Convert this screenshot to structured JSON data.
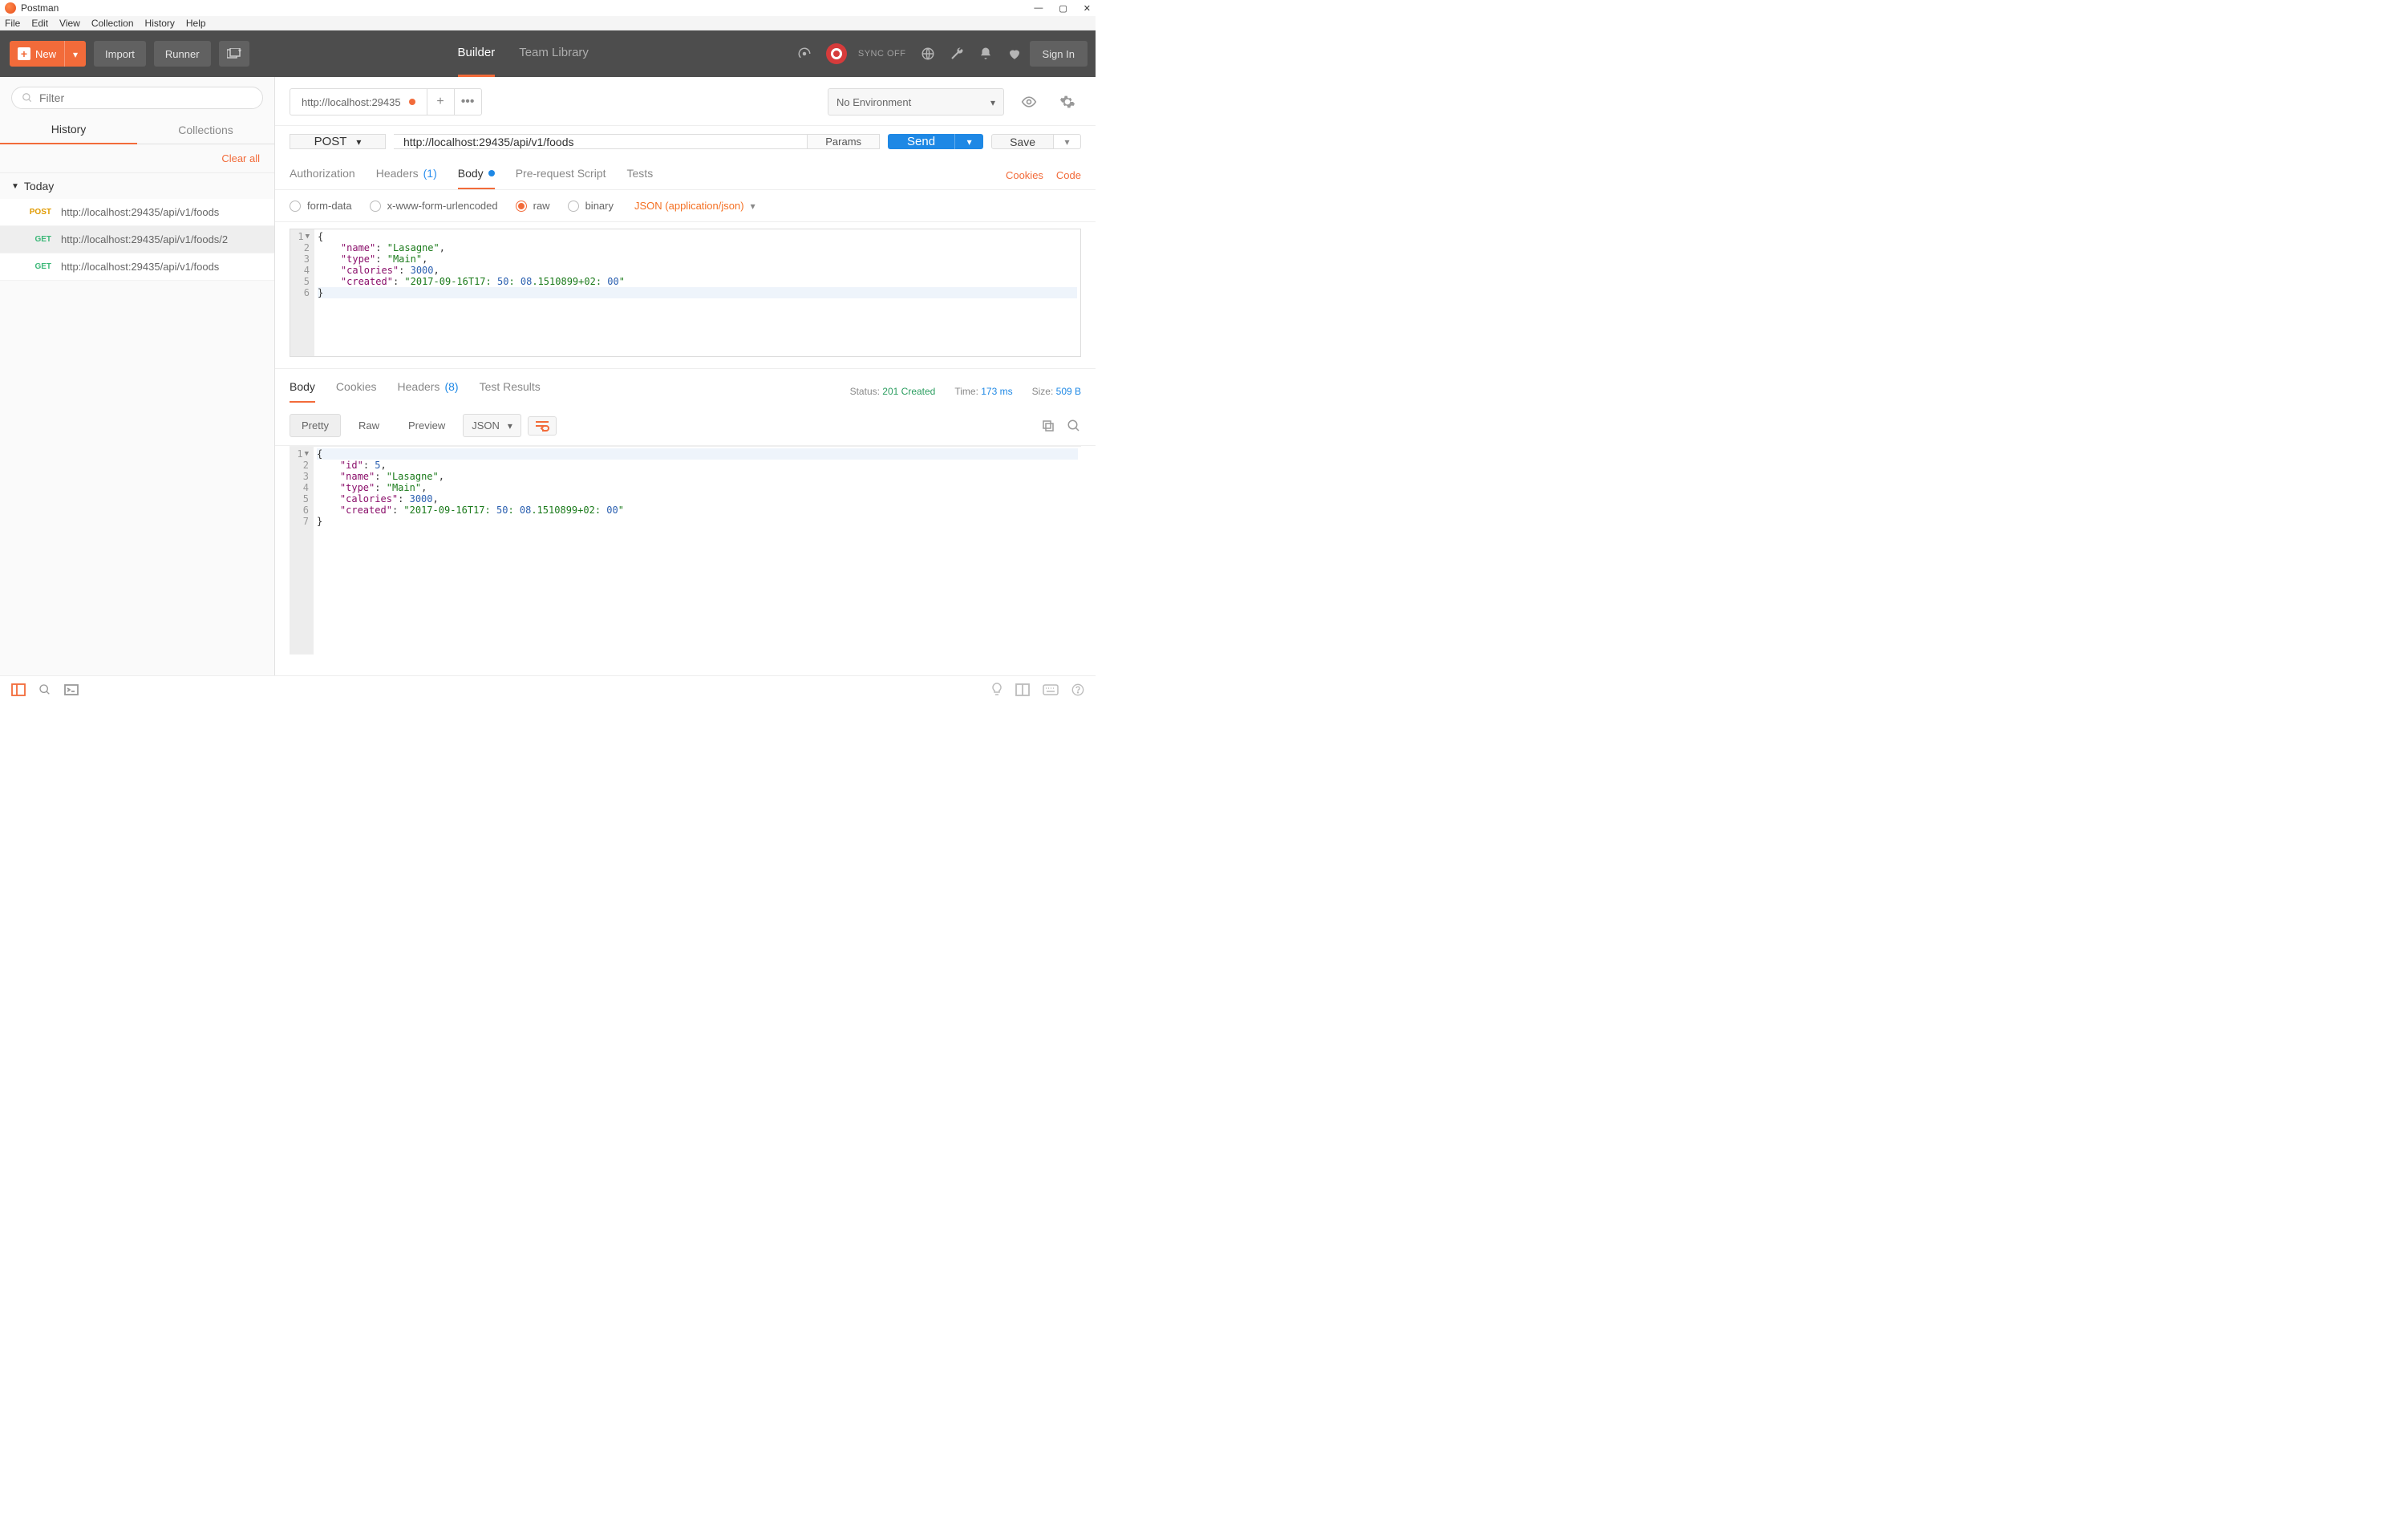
{
  "window": {
    "title": "Postman"
  },
  "menubar": [
    "File",
    "Edit",
    "View",
    "Collection",
    "History",
    "Help"
  ],
  "toolbar": {
    "new_label": "New",
    "import_label": "Import",
    "runner_label": "Runner",
    "tabs": {
      "builder": "Builder",
      "team_library": "Team Library"
    },
    "sync_label": "SYNC OFF",
    "sign_in": "Sign In"
  },
  "sidebar": {
    "filter_placeholder": "Filter",
    "tabs": {
      "history": "History",
      "collections": "Collections"
    },
    "clear_all": "Clear all",
    "group": "Today",
    "history": [
      {
        "method": "POST",
        "url": "http://localhost:29435/api/v1/foods",
        "selected": false
      },
      {
        "method": "GET",
        "url": "http://localhost:29435/api/v1/foods/2",
        "selected": true
      },
      {
        "method": "GET",
        "url": "http://localhost:29435/api/v1/foods",
        "selected": false
      }
    ]
  },
  "request": {
    "tab_title": "http://localhost:29435",
    "environment": "No Environment",
    "method": "POST",
    "url": "http://localhost:29435/api/v1/foods",
    "params_label": "Params",
    "send_label": "Send",
    "save_label": "Save",
    "subtabs": {
      "authorization": "Authorization",
      "headers": "Headers",
      "headers_count": "(1)",
      "body": "Body",
      "prerequest": "Pre-request Script",
      "tests": "Tests"
    },
    "cookies_label": "Cookies",
    "code_label": "Code",
    "body_types": {
      "form_data": "form-data",
      "x_www": "x-www-form-urlencoded",
      "raw": "raw",
      "binary": "binary"
    },
    "content_type": "JSON (application/json)",
    "body_lines": [
      "{",
      "    \"name\": \"Lasagne\",",
      "    \"type\": \"Main\",",
      "    \"calories\": 3000,",
      "    \"created\": \"2017-09-16T17:50:08.1510899+02:00\"",
      "}"
    ]
  },
  "response": {
    "tabs": {
      "body": "Body",
      "cookies": "Cookies",
      "headers": "Headers",
      "headers_count": "(8)",
      "tests": "Test Results"
    },
    "status_label": "Status:",
    "status_value": "201 Created",
    "time_label": "Time:",
    "time_value": "173 ms",
    "size_label": "Size:",
    "size_value": "509 B",
    "view_modes": {
      "pretty": "Pretty",
      "raw": "Raw",
      "preview": "Preview"
    },
    "lang": "JSON",
    "body_lines": [
      "{",
      "    \"id\": 5,",
      "    \"name\": \"Lasagne\",",
      "    \"type\": \"Main\",",
      "    \"calories\": 3000,",
      "    \"created\": \"2017-09-16T17:50:08.1510899+02:00\"",
      "}"
    ]
  }
}
